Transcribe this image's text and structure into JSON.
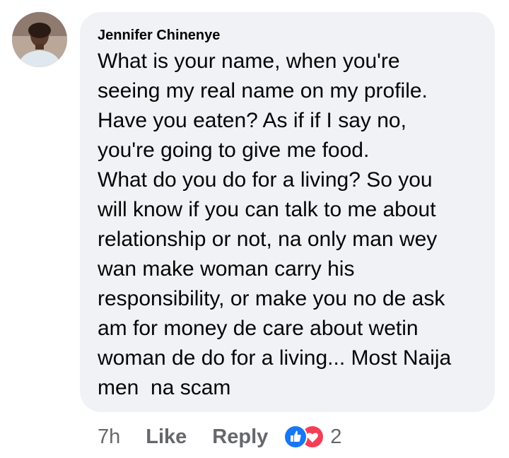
{
  "comment": {
    "author": "Jennifer Chinenye",
    "text_lines": [
      "What is your name, when you're",
      "seeing my real name on my profile.",
      "Have you eaten? As if if I say no,",
      "you're going to give me food.",
      "What do you do for a living? So you",
      "will know if you can talk to me about",
      "relationship or not, na only man wey",
      "wan make woman carry his",
      "responsibility, or make you no de ask",
      "am for money de care about wetin",
      "woman de do for a living... Most Naija",
      "men  na scam"
    ],
    "timestamp": "7h",
    "like_label": "Like",
    "reply_label": "Reply",
    "reaction_count": "2",
    "reaction_icons": [
      "like-icon",
      "love-icon"
    ]
  },
  "colors": {
    "bubble_bg": "#f0f2f5",
    "text": "#050505",
    "meta_text": "#65676b",
    "like_blue": "#1877f2",
    "love_red": "#f33e58"
  }
}
